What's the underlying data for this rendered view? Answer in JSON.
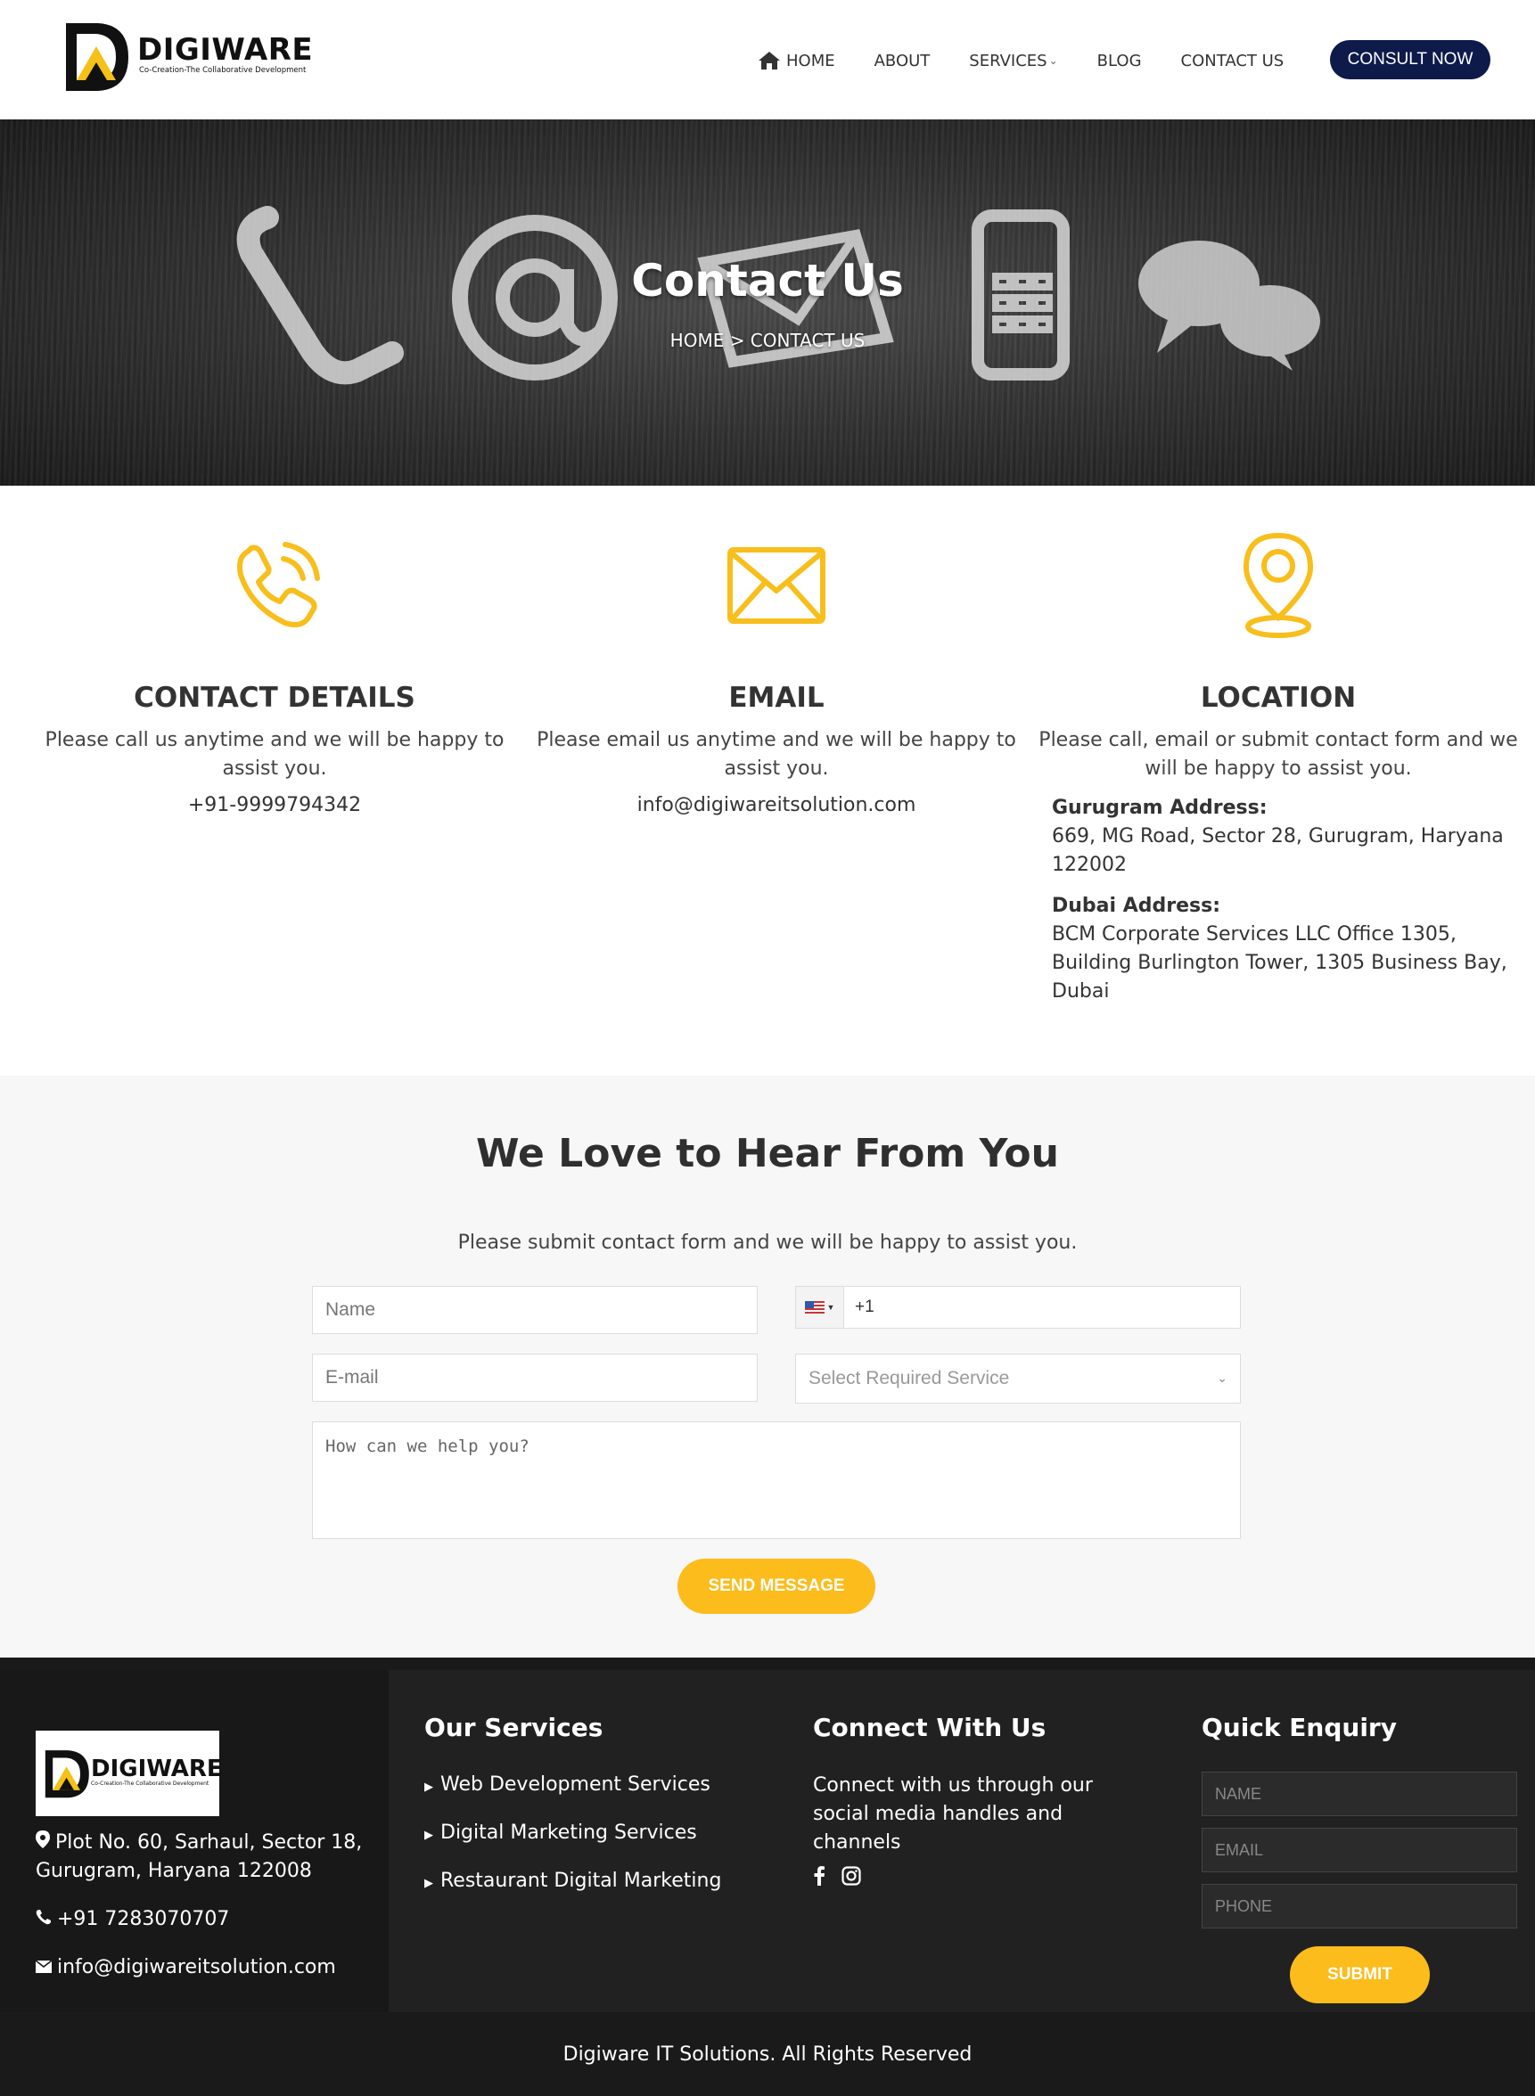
{
  "header": {
    "logo_title": "DIGIWARE",
    "logo_tagline": "Co-Creation-The Collaborative Development",
    "nav": [
      {
        "label": "HOME",
        "icon": "home-icon"
      },
      {
        "label": "ABOUT"
      },
      {
        "label": "SERVICES",
        "icon": "chevron-down-icon"
      },
      {
        "label": "BLOG"
      },
      {
        "label": "CONTACT US"
      }
    ],
    "cta_label": "CONSULT NOW",
    "cta_color": "#0e1a4a"
  },
  "hero": {
    "title": "Contact Us",
    "breadcrumb": "HOME > CONTACT US"
  },
  "info": {
    "contact": {
      "title": "CONTACT DETAILS",
      "desc": "Please call us anytime and we will be happy to assist you.",
      "value": "+91-9999794342",
      "icon": "phone-icon"
    },
    "email": {
      "title": "EMAIL",
      "desc": "Please email us anytime and we will be happy to assist you.",
      "value": "info@digiwareitsolution.com",
      "icon": "envelope-icon"
    },
    "location": {
      "title": "LOCATION",
      "desc": "Please call, email or submit contact form and we will be happy to assist you.",
      "gurugram_label": "Gurugram Address:",
      "gurugram_address": "669, MG Road, Sector 28, Gurugram, Haryana 122002",
      "dubai_label": "Dubai Address:",
      "dubai_address": "BCM Corporate Services LLC Office 1305, Building Burlington Tower, 1305 Business Bay, Dubai",
      "icon": "map-pin-icon"
    }
  },
  "form": {
    "heading": "We Love to Hear From You",
    "subheading": "Please submit contact form and we will be happy to assist you.",
    "name_placeholder": "Name",
    "phone_value": "+1",
    "email_placeholder": "E-mail",
    "service_placeholder": "Select Required Service",
    "message_placeholder": "How can we help you?",
    "submit_label": "SEND MESSAGE",
    "accent_color": "#fcbc1b"
  },
  "footer": {
    "logo_title": "DIGIWARE",
    "logo_tagline": "Co-Creation-The Collaborative Development",
    "address": "Plot No. 60, Sarhaul, Sector 18, Gurugram, Haryana 122008",
    "phone": "+91 7283070707",
    "email": "info@digiwareitsolution.com",
    "services_title": "Our Services",
    "services": [
      "Web Development Services",
      "Digital Marketing Services",
      "Restaurant Digital Marketing"
    ],
    "connect_title": "Connect With Us",
    "connect_text": "Connect with us through our social media handles and channels",
    "social_icons": [
      "facebook-icon",
      "instagram-icon"
    ],
    "enquiry_title": "Quick Enquiry",
    "enquiry_name": "NAME",
    "enquiry_email": "EMAIL",
    "enquiry_phone": "PHONE",
    "enquiry_submit": "SUBMIT",
    "copyright": "Digiware IT Solutions. All Rights Reserved"
  }
}
